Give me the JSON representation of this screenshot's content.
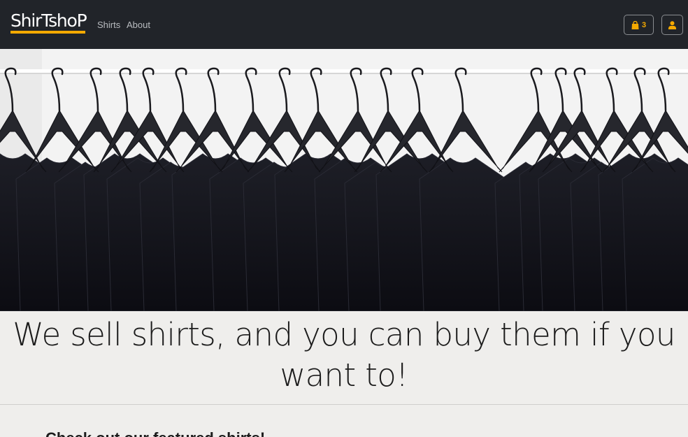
{
  "navbar": {
    "brand": "ShirTshoP",
    "links": [
      {
        "label": "Shirts"
      },
      {
        "label": "About"
      }
    ],
    "cart": {
      "count": "3",
      "icon": "shopping-bag-icon"
    },
    "account": {
      "icon": "user-icon"
    },
    "colors": {
      "background": "#212429",
      "accent": "#f4a900"
    }
  },
  "hero": {
    "image": "black t-shirts on hangers on a clothing rack"
  },
  "main": {
    "tagline": "We sell shirts, and you can buy them if you want to!",
    "section_heading": "Check out our featured shirts!"
  }
}
